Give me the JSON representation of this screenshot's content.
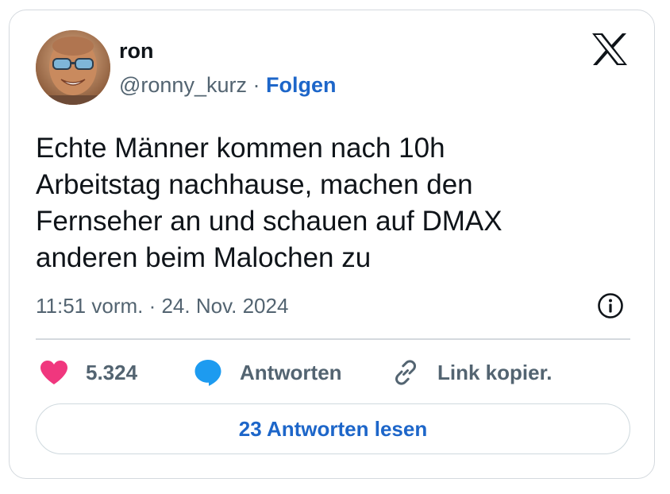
{
  "author": {
    "display_name": "ron",
    "handle": "@ronny_kurz",
    "separator": "·",
    "follow_label": "Folgen"
  },
  "tweet": {
    "text": "Echte Männer kommen nach 10h\nArbeitstag nachhause, machen den\nFernseher an und schauen auf DMAX\nanderen beim Malochen zu",
    "timestamp": "11:51 vorm. · 24. Nov. 2024"
  },
  "actions": {
    "like_count": "5.324",
    "reply_label": "Antworten",
    "copy_link_label": "Link kopier."
  },
  "read_replies_label": "23 Antworten lesen",
  "colors": {
    "accent": "#1d66c9",
    "like": "#f91880",
    "reply_bubble": "#1d9bf0",
    "text": "#0f1419",
    "secondary": "#536471"
  },
  "icons": {
    "brand": "x-logo-icon",
    "info": "info-icon",
    "like": "heart-icon",
    "reply": "speech-bubble-icon",
    "link": "link-icon"
  }
}
